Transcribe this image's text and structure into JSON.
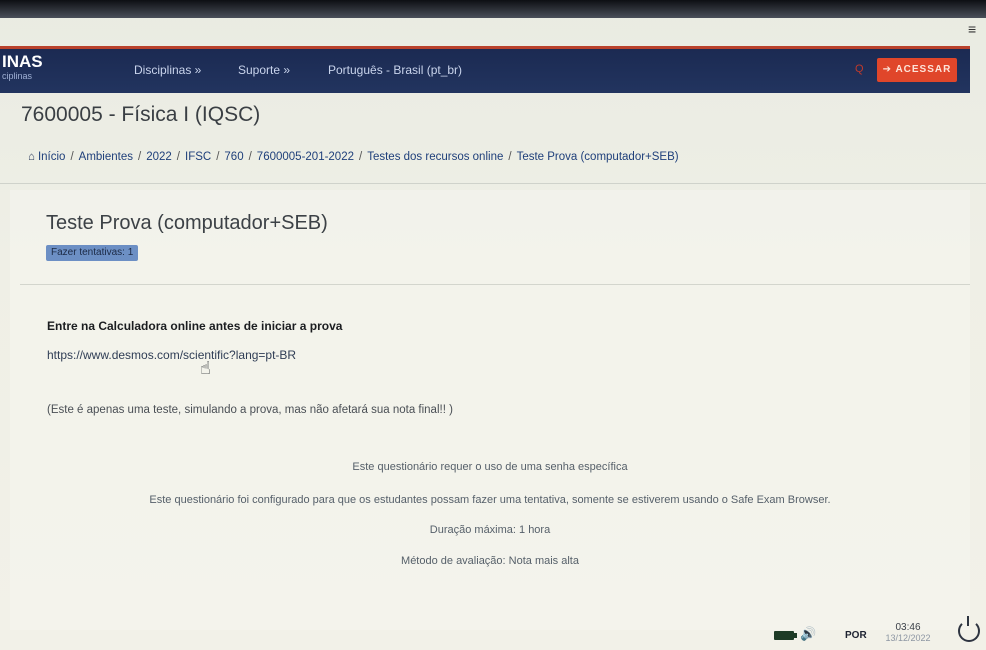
{
  "navbar": {
    "brand_title": "INAS",
    "brand_sub": "ciplinas",
    "items": [
      "Disciplinas »",
      "Suporte »",
      "Português - Brasil (pt_br)"
    ],
    "login_label": "ACESSAR"
  },
  "course": {
    "title": "7600005 - Física I (IQSC)"
  },
  "breadcrumb": [
    "Início",
    "Ambientes",
    "2022",
    "IFSC",
    "760",
    "7600005-201-2022",
    "Testes dos recursos online",
    "Teste Prova (computador+SEB)"
  ],
  "quiz": {
    "title": "Teste Prova (computador+SEB)",
    "attempts_badge": "Fazer tentativas: 1",
    "instruction_title": "Entre na Calculadora online antes de iniciar a prova",
    "link": "https://www.desmos.com/scientific?lang=pt-BR",
    "note": "(Este é apenas uma teste, simulando a prova, mas não afetará sua nota final!! )",
    "info": [
      "Este questionário requer o uso de uma senha específica",
      "Este questionário foi configurado para que os estudantes possam fazer uma tentativa, somente se estiverem usando o Safe Exam Browser.",
      "Duração máxima: 1 hora",
      "Método de avaliação: Nota mais alta"
    ]
  },
  "taskbar": {
    "lang": "POR",
    "time": "03:46",
    "date": "13/12/2022"
  },
  "colors": {
    "navbar": "#1b2a52",
    "accent": "#e0462a",
    "badge": "#6c8fc4"
  }
}
